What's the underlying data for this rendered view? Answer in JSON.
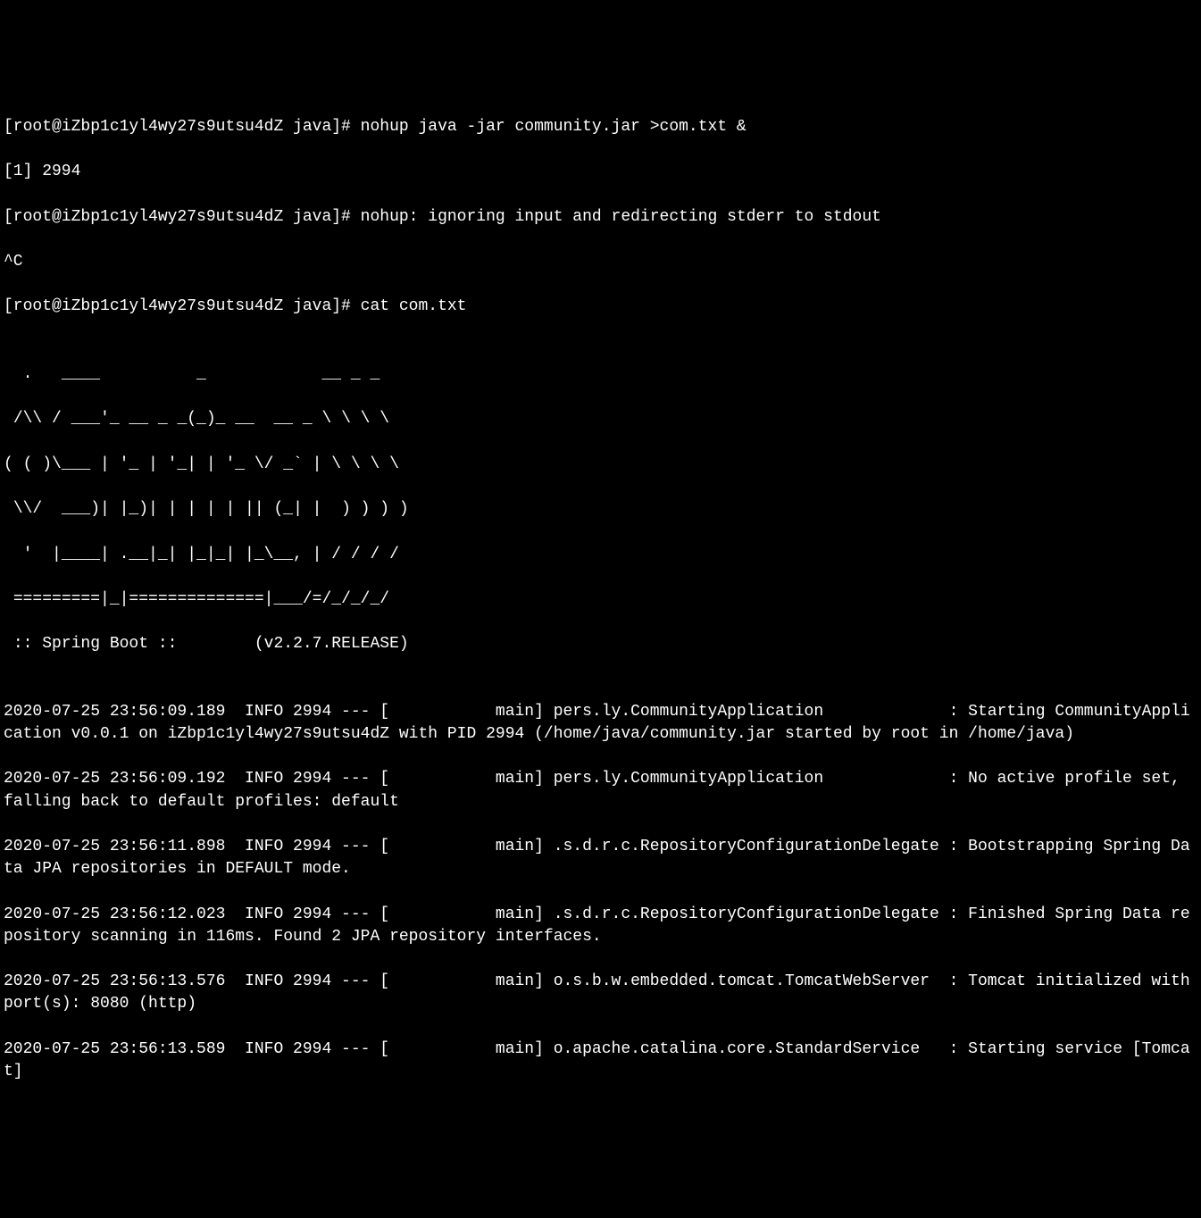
{
  "terminal": {
    "lines": [
      "[root@iZbp1c1yl4wy27s9utsu4dZ java]# nohup java -jar community.jar >com.txt &",
      "[1] 2994",
      "[root@iZbp1c1yl4wy27s9utsu4dZ java]# nohup: ignoring input and redirecting stderr to stdout",
      "^C",
      "[root@iZbp1c1yl4wy27s9utsu4dZ java]# cat com.txt",
      "",
      "  .   ____          _            __ _ _",
      " /\\\\ / ___'_ __ _ _(_)_ __  __ _ \\ \\ \\ \\",
      "( ( )\\___ | '_ | '_| | '_ \\/ _` | \\ \\ \\ \\",
      " \\\\/  ___)| |_)| | | | | || (_| |  ) ) ) )",
      "  '  |____| .__|_| |_|_| |_\\__, | / / / /",
      " =========|_|==============|___/=/_/_/_/",
      " :: Spring Boot ::        (v2.2.7.RELEASE)",
      "",
      "2020-07-25 23:56:09.189  INFO 2994 --- [           main] pers.ly.CommunityApplication             : Starting CommunityApplication v0.0.1 on iZbp1c1yl4wy27s9utsu4dZ with PID 2994 (/home/java/community.jar started by root in /home/java)",
      "2020-07-25 23:56:09.192  INFO 2994 --- [           main] pers.ly.CommunityApplication             : No active profile set, falling back to default profiles: default",
      "2020-07-25 23:56:11.898  INFO 2994 --- [           main] .s.d.r.c.RepositoryConfigurationDelegate : Bootstrapping Spring Data JPA repositories in DEFAULT mode.",
      "2020-07-25 23:56:12.023  INFO 2994 --- [           main] .s.d.r.c.RepositoryConfigurationDelegate : Finished Spring Data repository scanning in 116ms. Found 2 JPA repository interfaces.",
      "2020-07-25 23:56:13.576  INFO 2994 --- [           main] o.s.b.w.embedded.tomcat.TomcatWebServer  : Tomcat initialized with port(s): 8080 (http)",
      "2020-07-25 23:56:13.589  INFO 2994 --- [           main] o.apache.catalina.core.StandardService   : Starting service [Tomcat]"
    ]
  }
}
